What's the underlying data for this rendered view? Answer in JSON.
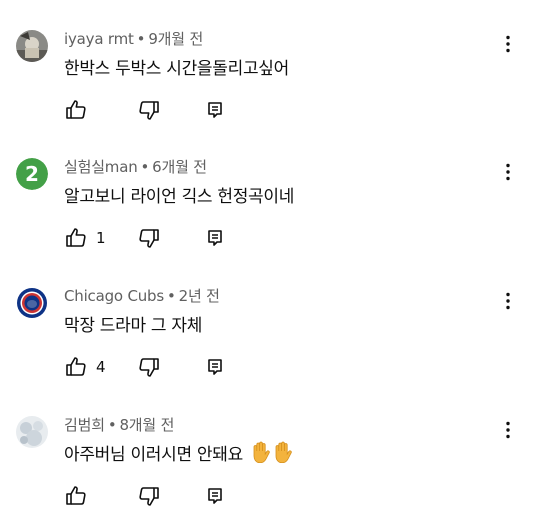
{
  "comments": [
    {
      "author": "iyaya rmt",
      "time": "9개월 전",
      "text": "한박스 두박스 시간을돌리고싶어",
      "likes": "",
      "avatar": "photo-gray"
    },
    {
      "author": "실험실man",
      "time": "6개월 전",
      "text": "알고보니 라이언 긱스 헌정곡이네",
      "likes": "1",
      "avatar": "green-digit",
      "avatar_label": "2",
      "avatar_color": "#43a047"
    },
    {
      "author": "Chicago Cubs",
      "time": "2년 전",
      "text": "막장 드라마 그 자체",
      "likes": "4",
      "avatar": "cubs-logo",
      "avatar_color": "#0e3386"
    },
    {
      "author": "김범희",
      "time": "8개월 전",
      "text": "아주버님 이러시면 안돼요",
      "likes": "",
      "avatar": "photo-light",
      "emojis": [
        "raised-hand-icon",
        "raised-hand-icon"
      ]
    }
  ],
  "icons": {
    "like": "thumbs-up-icon",
    "dislike": "thumbs-down-icon",
    "reply": "reply-icon",
    "more": "more-vertical-icon"
  }
}
